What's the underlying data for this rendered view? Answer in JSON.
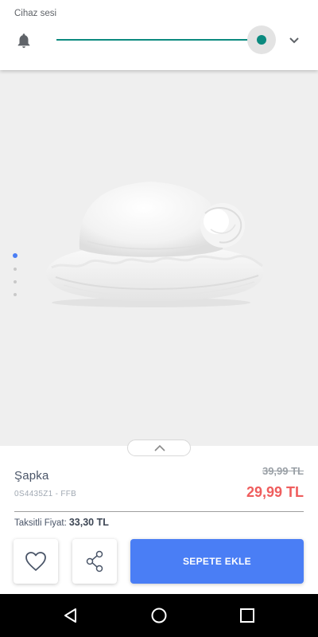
{
  "volume_panel": {
    "title": "Cihaz sesi",
    "level_percent": 100,
    "accent_color": "#0b8a7f",
    "icons": [
      "bell-icon",
      "chevron-down-icon"
    ]
  },
  "product_image": {
    "carousel_total": 4,
    "carousel_active_index": 0,
    "active_dot_color": "#4a7ef5"
  },
  "product": {
    "name": "Şapka",
    "code": "0S4435Z1 - FFB",
    "old_price": "39,99 TL",
    "new_price": "29,99 TL",
    "installment_label": "Taksitli Fiyat:",
    "installment_value": "33,30 TL"
  },
  "actions": {
    "favorite_icon": "heart-icon",
    "share_icon": "share-icon",
    "add_to_cart_label": "SEPETE EKLE",
    "primary_color": "#4a7ef5",
    "sale_price_color": "#ef5d5d"
  },
  "nav_bar": {
    "icons": [
      "back-icon",
      "home-icon",
      "recents-icon"
    ]
  }
}
